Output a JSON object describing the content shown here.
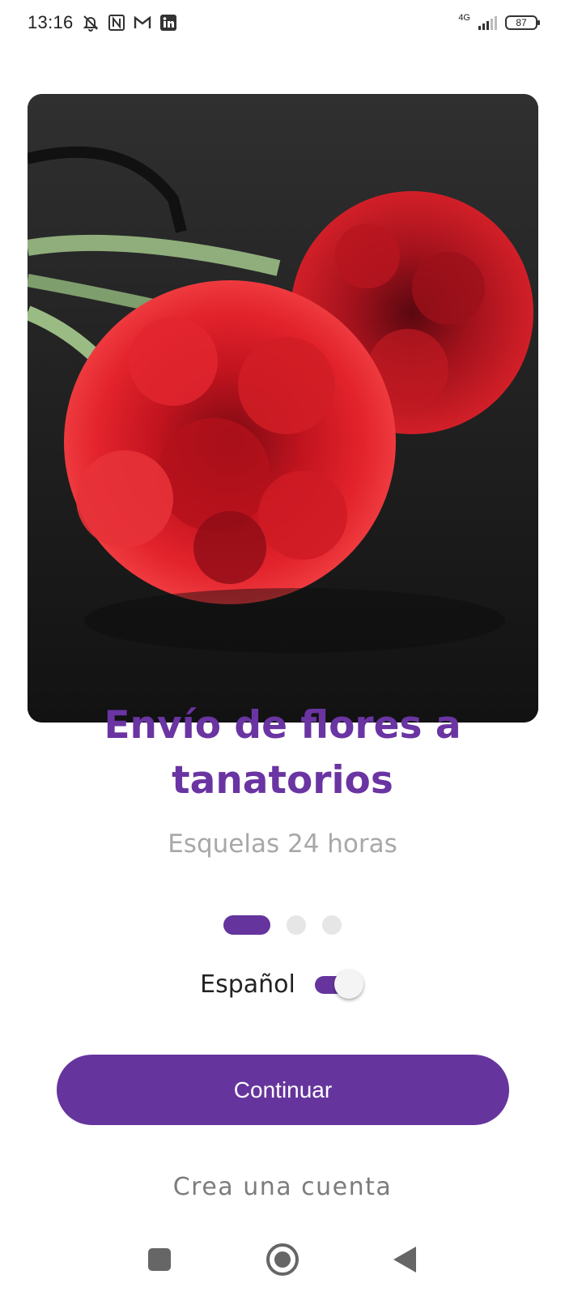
{
  "status_bar": {
    "time": "13:16",
    "network": "4G",
    "battery": "87",
    "icons": [
      "silent-bell-icon",
      "nfc-icon",
      "gmail-icon",
      "linkedin-icon",
      "signal-icon",
      "battery-icon"
    ]
  },
  "hero": {
    "image": "red-carnations-photo"
  },
  "slide": {
    "title": "Envío de flores a tanatorios",
    "subtitle": "Esquelas 24 horas"
  },
  "pager": {
    "count": 3,
    "active_index": 0
  },
  "language": {
    "label": "Español",
    "enabled": true
  },
  "actions": {
    "continue_label": "Continuar",
    "create_account_label": "Crea una cuenta"
  },
  "nav": {
    "icons": [
      "recents-square-icon",
      "home-circle-icon",
      "back-triangle-icon"
    ]
  },
  "colors": {
    "accent": "#65359d",
    "title": "#6a34a2",
    "subtitle": "#a8a8a8",
    "link": "#7c7c7c"
  }
}
